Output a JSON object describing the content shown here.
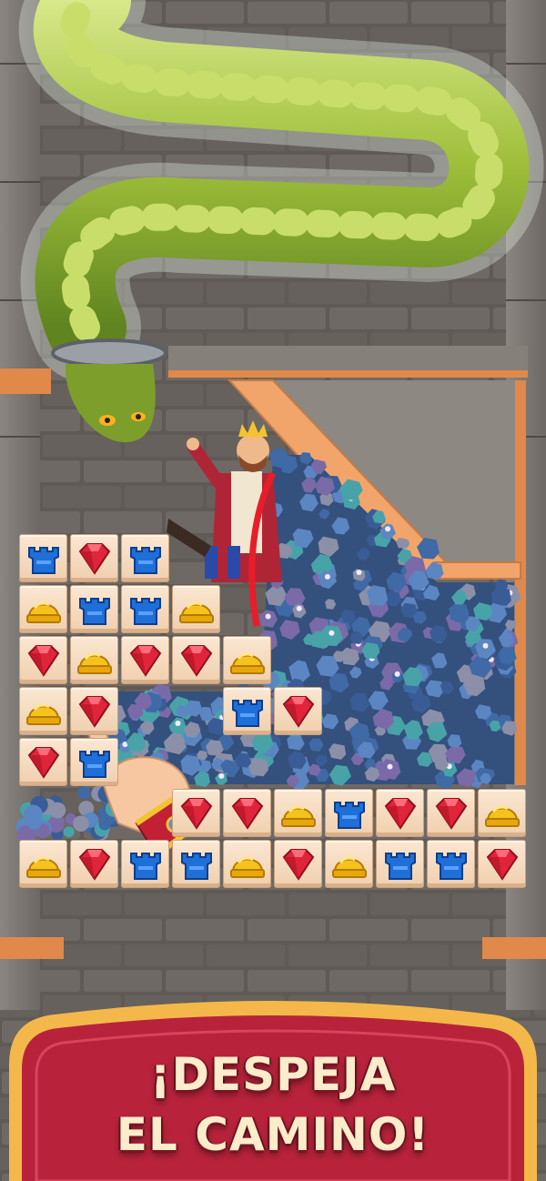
{
  "banner": {
    "line1": "¡DESPEJA",
    "line2": "EL CAMINO!"
  },
  "colors": {
    "banner_fill": "#b8233b",
    "banner_border": "#f4b84a",
    "tile": "#f6dcc0",
    "gem_red": "#e0243a",
    "helmet_yellow": "#f6c21c",
    "tower_blue": "#1f6fd8",
    "snake_green": "#9fbf3a",
    "stone_wall": "#6a6560"
  },
  "board": {
    "rows": [
      [
        "tower",
        "gem",
        "tower",
        null,
        null,
        null,
        null,
        null,
        null,
        null
      ],
      [
        "helmet",
        "tower",
        "tower",
        "helmet",
        null,
        null,
        null,
        null,
        null,
        null
      ],
      [
        "gem",
        "helmet",
        "gem",
        "gem",
        "helmet",
        null,
        null,
        null,
        null,
        null
      ],
      [
        "helmet",
        "gem",
        null,
        null,
        "tower",
        "gem",
        null,
        null,
        null,
        null
      ],
      [
        "gem",
        "tower",
        null,
        null,
        null,
        null,
        null,
        null,
        null,
        null
      ],
      [
        null,
        null,
        null,
        "gem",
        "gem",
        "helmet",
        "tower",
        "gem",
        "gem",
        "helmet"
      ],
      [
        "helmet",
        "gem",
        "tower",
        "tower",
        "helmet",
        "gem",
        "helmet",
        "tower",
        "tower",
        "gem"
      ]
    ]
  },
  "icons": {
    "snake": "snake-icon",
    "king": "king-character",
    "hand": "tutorial-hand-icon",
    "gem": "red-gem-icon",
    "helmet": "yellow-helmet-icon",
    "tower": "blue-tower-icon"
  }
}
